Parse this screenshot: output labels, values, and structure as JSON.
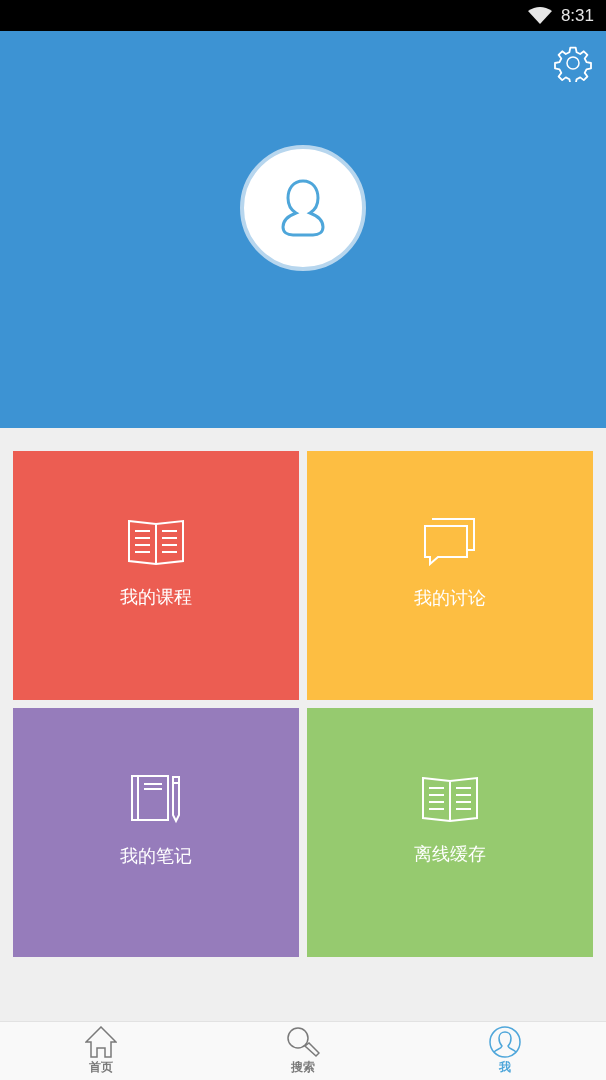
{
  "status_bar": {
    "time": "8:31"
  },
  "tiles": [
    {
      "label": "我的课程",
      "kind": "book",
      "color": "#ec5d52"
    },
    {
      "label": "我的讨论",
      "kind": "chat",
      "color": "#fdbe42"
    },
    {
      "label": "我的笔记",
      "kind": "notebook",
      "color": "#967cbb"
    },
    {
      "label": "离线缓存",
      "kind": "book",
      "color": "#96ca6f"
    }
  ],
  "nav": [
    {
      "label": "首页",
      "kind": "home",
      "selected": false
    },
    {
      "label": "搜索",
      "kind": "search",
      "selected": false
    },
    {
      "label": "我",
      "kind": "profile",
      "selected": true
    }
  ]
}
